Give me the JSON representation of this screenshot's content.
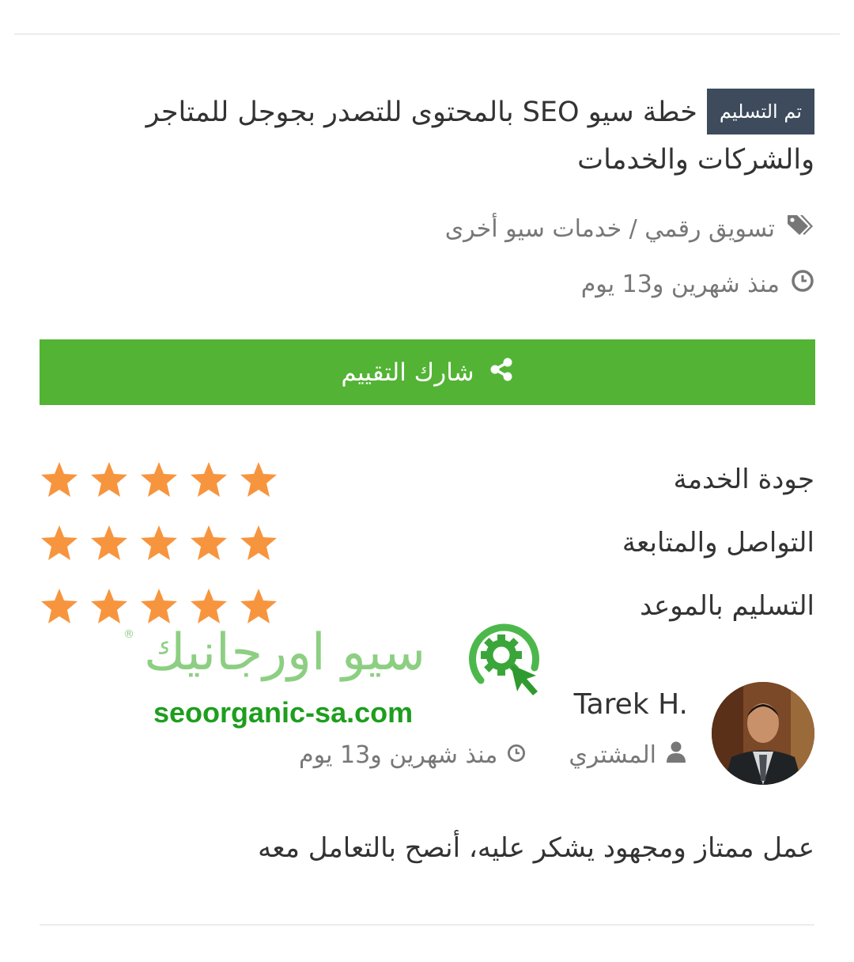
{
  "order": {
    "status_badge": "تم التسليم",
    "title": "خطة سيو SEO بالمحتوى للتصدر بجوجل للمتاجر والشركات والخدمات",
    "category": "تسويق رقمي / خدمات سيو أخرى",
    "time_ago": "منذ شهرين و13 يوم"
  },
  "share": {
    "label": "شارك التقييم"
  },
  "ratings": [
    {
      "label": "جودة الخدمة",
      "stars": 5,
      "max": 5
    },
    {
      "label": "التواصل والمتابعة",
      "stars": 5,
      "max": 5
    },
    {
      "label": "التسليم بالموعد",
      "stars": 5,
      "max": 5
    }
  ],
  "watermark": {
    "brand_ar": "سيو اورجانيك",
    "registered": "®",
    "url": "seoorganic-sa.com"
  },
  "review": {
    "name": "Tarek H.",
    "role": "المشتري",
    "time_ago": "منذ شهرين و13 يوم",
    "comment": "عمل ممتاز ومجهود يشكر عليه، أنصح بالتعامل معه"
  },
  "colors": {
    "badge_bg": "#3d4b5c",
    "share_green": "#53b335",
    "star_orange": "#f7953f",
    "watermark_green": "#1e9e1e"
  },
  "icons": [
    "tags-icon",
    "clock-icon",
    "share-icon",
    "star-icon",
    "user-icon",
    "logo-gear-icon"
  ]
}
